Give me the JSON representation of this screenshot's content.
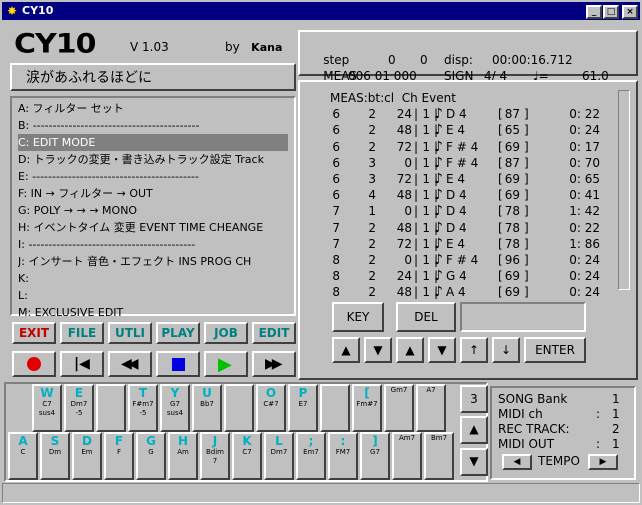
{
  "window": {
    "title": "CY10",
    "logo": "CY10",
    "version": "V 1.03",
    "author_prefix": "by",
    "author_name": "Kana"
  },
  "song_title": "涙があふれるほどに",
  "menu": [
    "A: フィルター セット",
    "B: ------------------------------------------",
    "C: EDIT MODE",
    "D: トラックの変更・書き込みトラック設定 Track",
    "E: ------------------------------------------",
    "F: IN  →  フィルター  →  OUT",
    "G: POLY  →  →  →  MONO",
    "H: イベントタイム 変更   EVENT TIME CHEANGE",
    "I: ------------------------------------------",
    "J: インサート 音色・エフェクト  INS PROG CH",
    "K:",
    "L:",
    "M: EXCLUSIVE EDIT"
  ],
  "selected_menu_index": 2,
  "status": {
    "step_label": "step",
    "step_a": "0",
    "step_b": "0",
    "disp_label": "disp:",
    "disp_time": "00:00:16.712",
    "meas_label": "MEAS",
    "meas_value": "006 01 000",
    "sign_label": "SIGN",
    "sign_value": "4/ 4",
    "tempo_symbol": "♩=",
    "tempo_value": "61.0"
  },
  "event_header": "MEAS:bt:cl  Ch Event",
  "events": [
    {
      "meas": "6",
      "bt": "2",
      "cl": "24",
      "ch": "1",
      "note": "D 4",
      "vel": "87",
      "gate": "0: 22"
    },
    {
      "meas": "6",
      "bt": "2",
      "cl": "48",
      "ch": "1",
      "note": "E 4",
      "vel": "65",
      "gate": "0: 24"
    },
    {
      "meas": "6",
      "bt": "2",
      "cl": "72",
      "ch": "1",
      "note": "F # 4",
      "vel": "69",
      "gate": "0: 17"
    },
    {
      "meas": "6",
      "bt": "3",
      "cl": "0",
      "ch": "1",
      "note": "F # 4",
      "vel": "87",
      "gate": "0: 70"
    },
    {
      "meas": "6",
      "bt": "3",
      "cl": "72",
      "ch": "1",
      "note": "E 4",
      "vel": "69",
      "gate": "0: 65"
    },
    {
      "meas": "6",
      "bt": "4",
      "cl": "48",
      "ch": "1",
      "note": "D 4",
      "vel": "69",
      "gate": "0: 41"
    },
    {
      "meas": "7",
      "bt": "1",
      "cl": "0",
      "ch": "1",
      "note": "D 4",
      "vel": "78",
      "gate": "1: 42"
    },
    {
      "meas": "7",
      "bt": "2",
      "cl": "48",
      "ch": "1",
      "note": "D 4",
      "vel": "78",
      "gate": "0: 22"
    },
    {
      "meas": "7",
      "bt": "2",
      "cl": "72",
      "ch": "1",
      "note": "E 4",
      "vel": "78",
      "gate": "1: 86"
    },
    {
      "meas": "8",
      "bt": "2",
      "cl": "0",
      "ch": "1",
      "note": "F # 4",
      "vel": "96",
      "gate": "0: 24"
    },
    {
      "meas": "8",
      "bt": "2",
      "cl": "24",
      "ch": "1",
      "note": "G 4",
      "vel": "69",
      "gate": "0: 24"
    },
    {
      "meas": "8",
      "bt": "2",
      "cl": "48",
      "ch": "1",
      "note": "A 4",
      "vel": "69",
      "gate": "0: 24"
    }
  ],
  "edit_buttons": {
    "key": "KEY",
    "del": "DEL",
    "enter": "ENTER"
  },
  "modes": [
    {
      "label": "EXIT",
      "color": "#c00000"
    },
    {
      "label": "FILE",
      "color": "#008080"
    },
    {
      "label": "UTLI",
      "color": "#008080"
    },
    {
      "label": "PLAY",
      "color": "#008080"
    },
    {
      "label": "JOB",
      "color": "#008080"
    },
    {
      "label": "EDIT",
      "color": "#008080"
    }
  ],
  "keyboard": {
    "octave": "3",
    "black_keys": [
      {
        "key": "W",
        "chord1": "C7",
        "chord2": "sus4"
      },
      {
        "key": "E",
        "chord1": "Dm7",
        "chord2": "-5"
      },
      {
        "key": "T",
        "chord1": "F#m7",
        "chord2": "-5"
      },
      {
        "key": "Y",
        "chord1": "G7",
        "chord2": "sus4"
      },
      {
        "key": "U",
        "chord1": "Bb7",
        "chord2": ""
      },
      {
        "key": "O",
        "chord1": "C#7",
        "chord2": ""
      },
      {
        "key": "P",
        "chord1": "E7",
        "chord2": ""
      },
      {
        "key": "[",
        "chord1": "Fm#7",
        "chord2": ""
      },
      {
        "key": "",
        "chord1": "Gm7",
        "chord2": ""
      },
      {
        "key": "",
        "chord1": "A7",
        "chord2": ""
      }
    ],
    "white_keys": [
      {
        "key": "A",
        "chord1": "C",
        "chord2": ""
      },
      {
        "key": "S",
        "chord1": "Dm",
        "chord2": ""
      },
      {
        "key": "D",
        "chord1": "Em",
        "chord2": ""
      },
      {
        "key": "F",
        "chord1": "F",
        "chord2": ""
      },
      {
        "key": "G",
        "chord1": "G",
        "chord2": ""
      },
      {
        "key": "H",
        "chord1": "Am",
        "chord2": ""
      },
      {
        "key": "J",
        "chord1": "Bdim",
        "chord2": "7"
      },
      {
        "key": "K",
        "chord1": "C7",
        "chord2": ""
      },
      {
        "key": "L",
        "chord1": "Dm7",
        "chord2": ""
      },
      {
        "key": ";",
        "chord1": "Em7",
        "chord2": ""
      },
      {
        "key": ":",
        "chord1": "FM7",
        "chord2": ""
      },
      {
        "key": "]",
        "chord1": "G7",
        "chord2": ""
      },
      {
        "key": "",
        "chord1": "Am7",
        "chord2": ""
      },
      {
        "key": "",
        "chord1": "Bm7",
        "chord2": ""
      }
    ]
  },
  "song_info": {
    "bank_label": "SONG Bank",
    "bank_value": "1",
    "midich_label": "MIDI ch",
    "midich_value": "1",
    "rectrack_label": "REC TRACK:",
    "rectrack_value": "2",
    "midiout_label": "MIDI OUT",
    "midiout_value": "1",
    "tempo_label": "TEMPO"
  }
}
